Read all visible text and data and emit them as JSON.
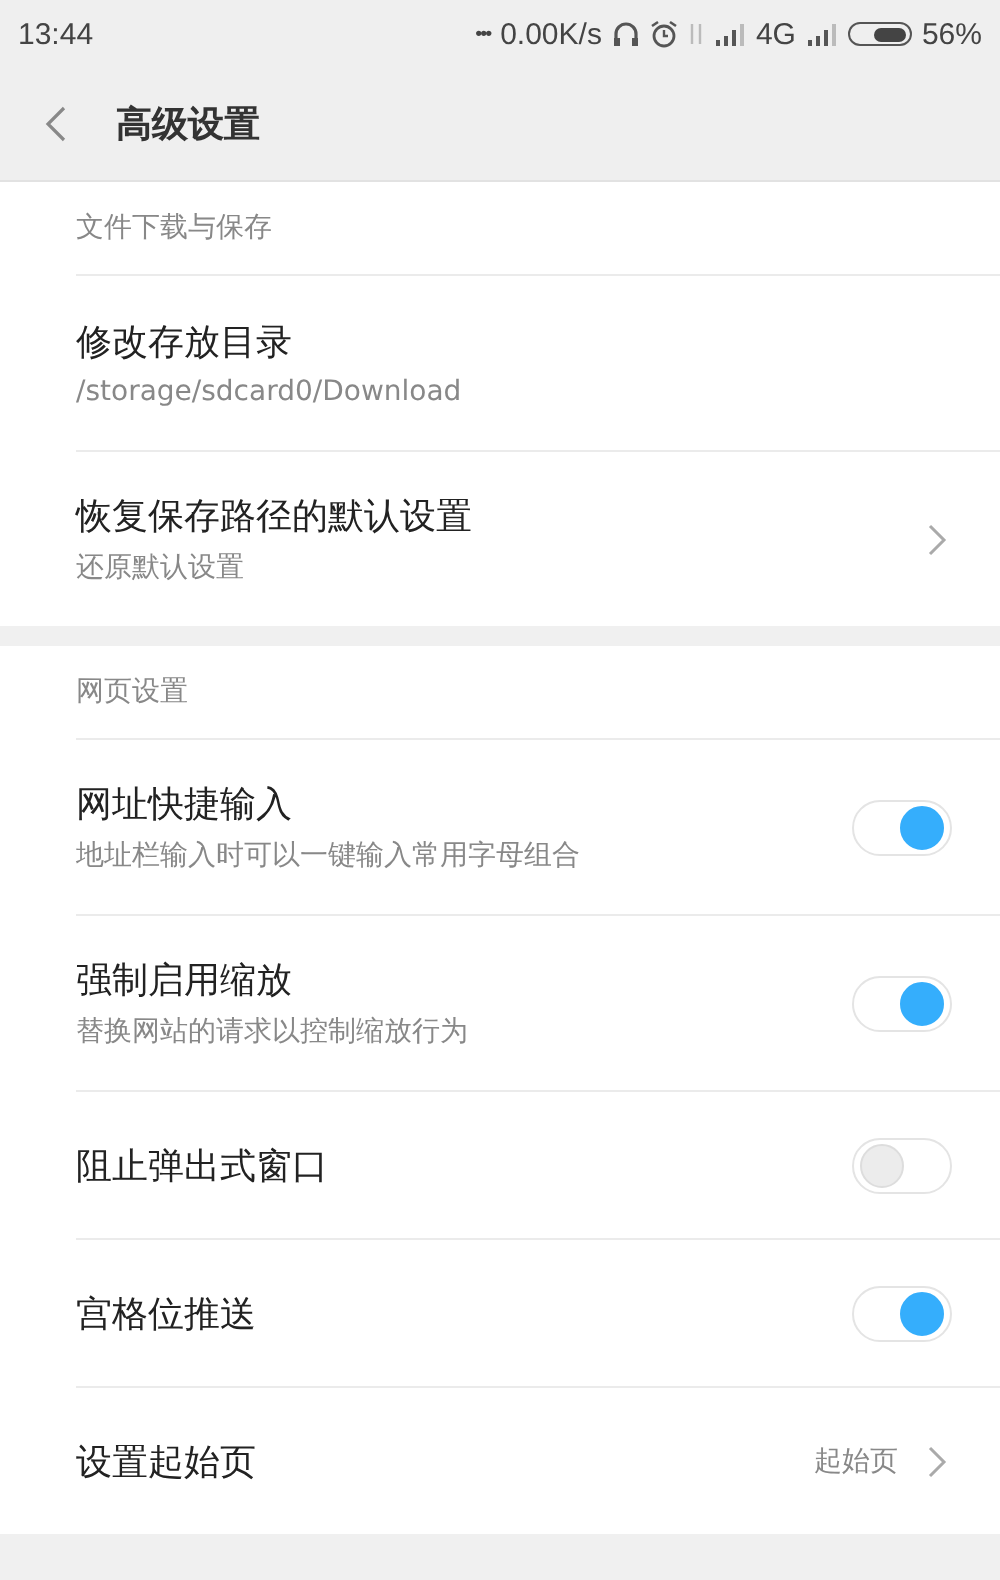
{
  "status_bar": {
    "time": "13:44",
    "dots": "•••",
    "speed": "0.00K/s",
    "network": "4G",
    "battery": "56%"
  },
  "header": {
    "title": "高级设置"
  },
  "sections": [
    {
      "title": "文件下载与保存",
      "items": [
        {
          "kind": "text",
          "title": "修改存放目录",
          "subtitle": "/storage/sdcard0/Download"
        },
        {
          "kind": "link",
          "title": "恢复保存路径的默认设置",
          "subtitle": "还原默认设置"
        }
      ]
    },
    {
      "title": "网页设置",
      "items": [
        {
          "kind": "toggle",
          "title": "网址快捷输入",
          "subtitle": "地址栏输入时可以一键输入常用字母组合",
          "on": true
        },
        {
          "kind": "toggle",
          "title": "强制启用缩放",
          "subtitle": "替换网站的请求以控制缩放行为",
          "on": true
        },
        {
          "kind": "toggle",
          "title": "阻止弹出式窗口",
          "on": false
        },
        {
          "kind": "toggle",
          "title": "宫格位推送",
          "on": true
        },
        {
          "kind": "link",
          "title": "设置起始页",
          "value": "起始页"
        }
      ]
    }
  ]
}
